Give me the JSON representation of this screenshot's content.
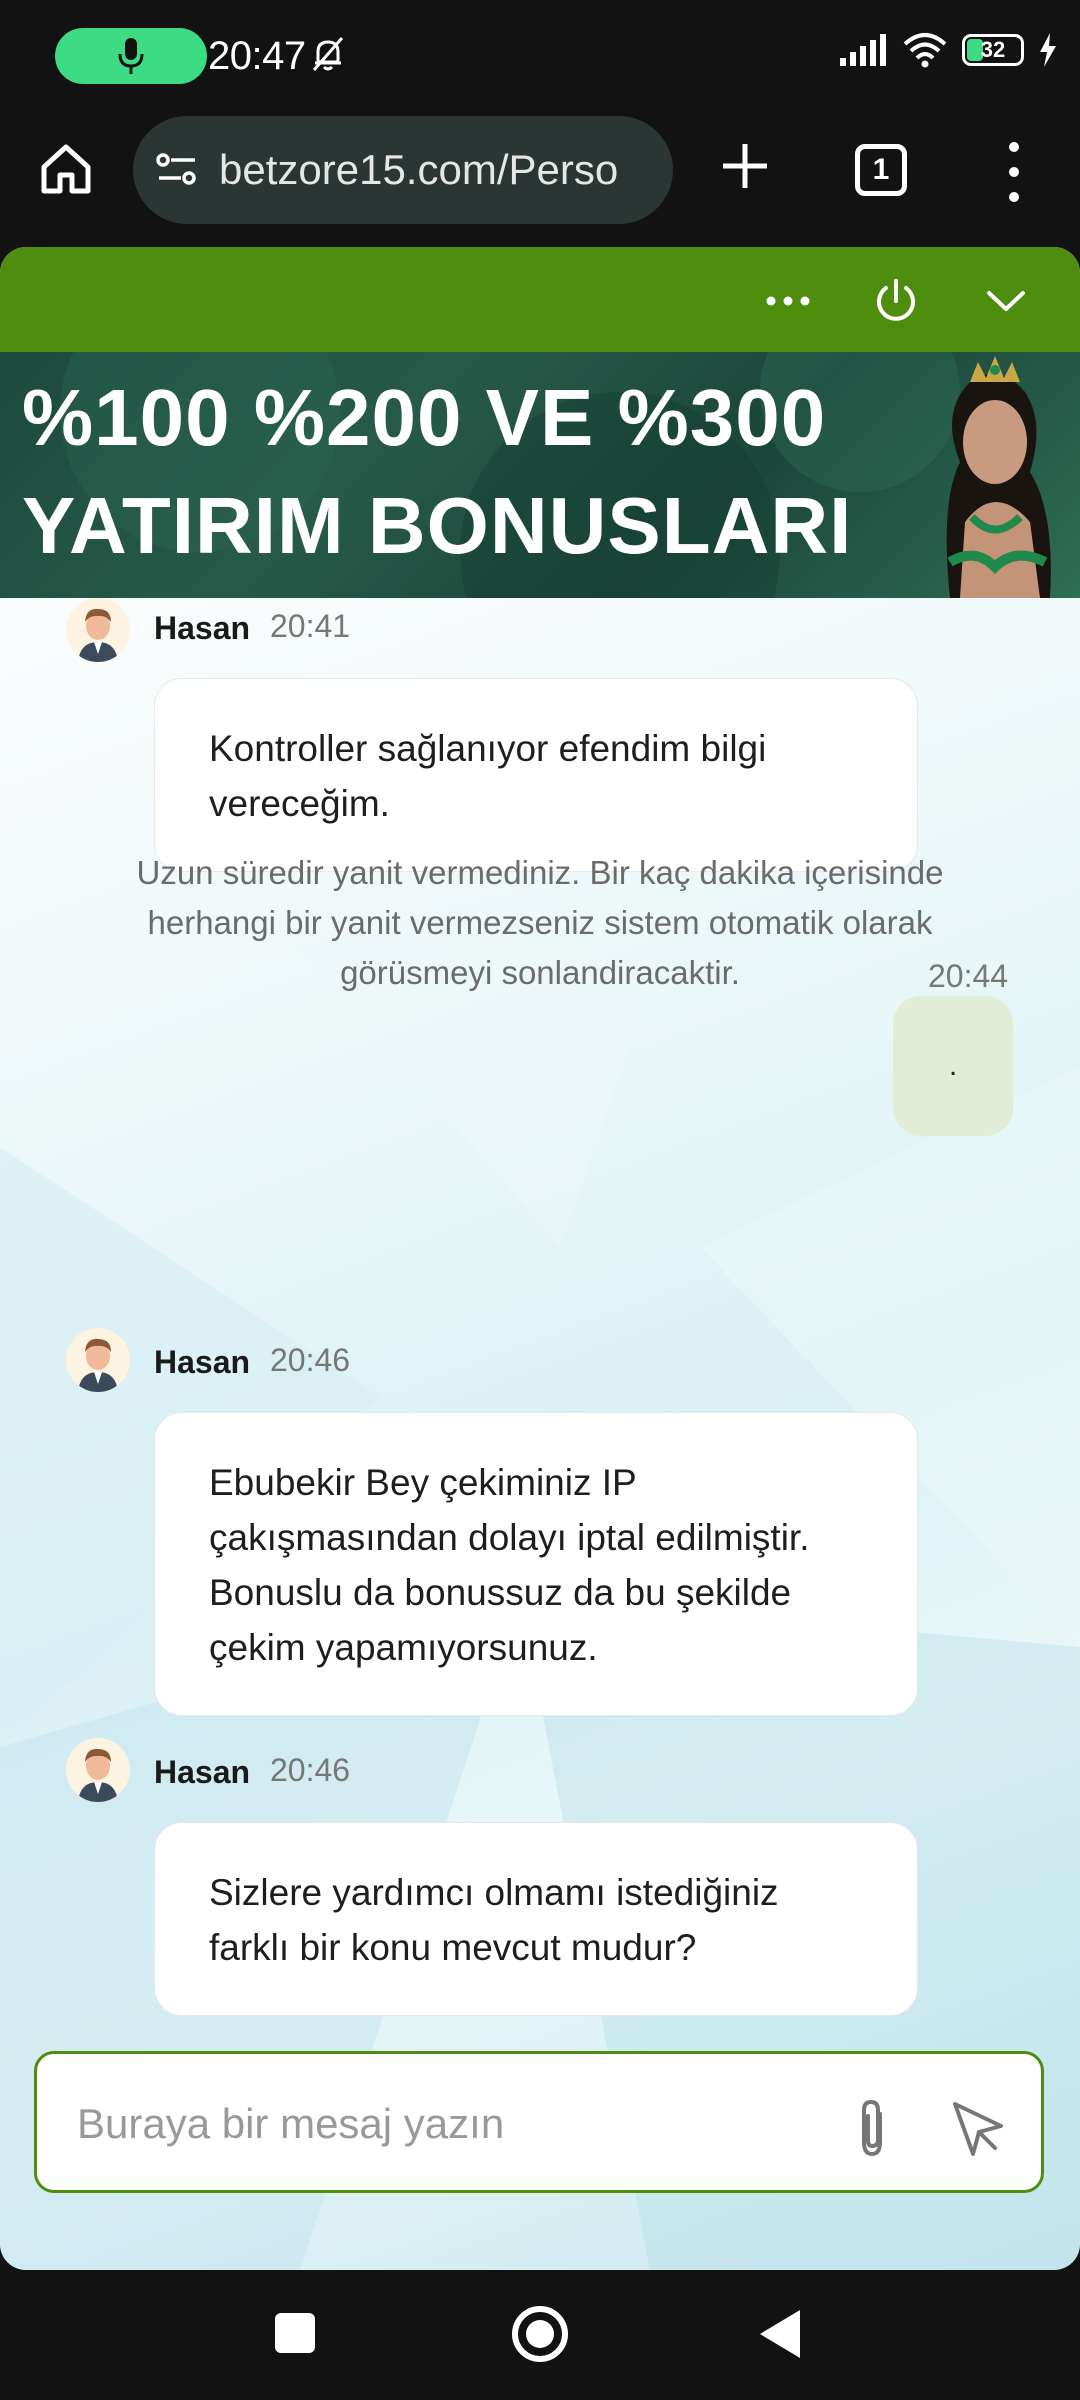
{
  "status_bar": {
    "time": "20:47",
    "battery_level": "32",
    "icons": [
      "mic-icon",
      "bell-off-icon",
      "signal-icon",
      "wifi-icon",
      "battery-icon",
      "charging-icon"
    ]
  },
  "browser": {
    "url": "betzore15.com/Perso",
    "tab_count": "1",
    "icons": [
      "home-icon",
      "site-settings-icon",
      "new-tab-icon",
      "tab-switcher-icon",
      "overflow-menu-icon"
    ]
  },
  "chat": {
    "header_icons": [
      "more-icon",
      "power-icon",
      "chevron-down-icon"
    ],
    "header_color": "#4e8d0e",
    "banner": {
      "line1": "%100 %200 VE %300",
      "line2": "YATIRIM BONUSLARI"
    },
    "messages": [
      {
        "sender": "Hasan",
        "time": "20:41",
        "text": "Kontroller sağlanıyor efendim bilgi vereceğim."
      },
      {
        "sender": "Hasan",
        "time": "20:46",
        "text": "Ebubekir Bey çekiminiz IP çakışmasından dolayı iptal edilmiştir. Bonuslu da bonussuz da bu şekilde çekim yapamıyorsunuz."
      },
      {
        "sender": "Hasan",
        "time": "20:46",
        "text": "Sizlere yardımcı olmamı istediğiniz farklı bir konu mevcut mudur?"
      }
    ],
    "system_notice": "Uzun süredir yanit vermediniz. Bir kaç dakika içerisinde herhangi bir yanit vermezseniz sistem otomatik olarak görüsmeyi sonlandiracaktir.",
    "user_message": {
      "time": "20:44",
      "text": "."
    },
    "composer": {
      "placeholder": "Buraya bir mesaj yazın",
      "value": ""
    }
  },
  "nav_bar": {
    "icons": [
      "recents-icon",
      "home-circle-icon",
      "back-icon"
    ]
  }
}
